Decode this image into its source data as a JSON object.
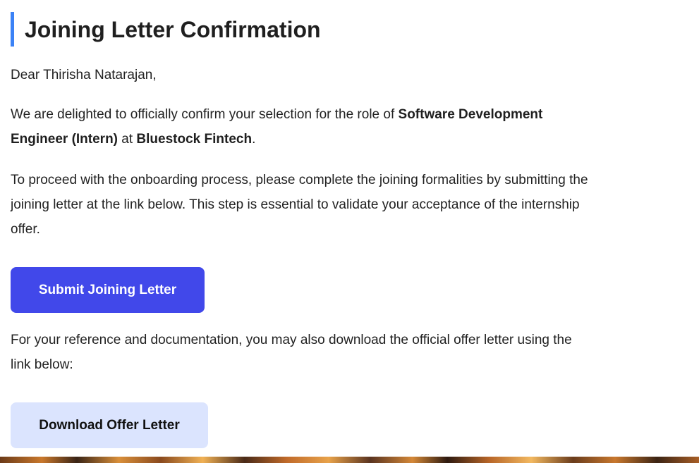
{
  "header": {
    "title": "Joining Letter Confirmation",
    "accent_color": "#3b82f6"
  },
  "body": {
    "greeting": "Dear Thirisha Natarajan,",
    "confirm": {
      "prefix": "We are delighted to officially confirm your selection for the role of ",
      "role": "Software Development Engineer (Intern)",
      "middle": " at ",
      "company": "Bluestock Fintech",
      "suffix": "."
    },
    "proceed_text": "To proceed with the onboarding process, please complete the joining formalities by submitting the joining letter at the link below. This step is essential to validate your acceptance of the internship offer.",
    "reference_text": "For your reference and documentation, you may also download the official offer letter using the link below:"
  },
  "actions": {
    "submit_label": "Submit Joining Letter",
    "submit_color": "#4148ea",
    "download_label": "Download Offer Letter",
    "download_color": "#dbe4fe"
  }
}
